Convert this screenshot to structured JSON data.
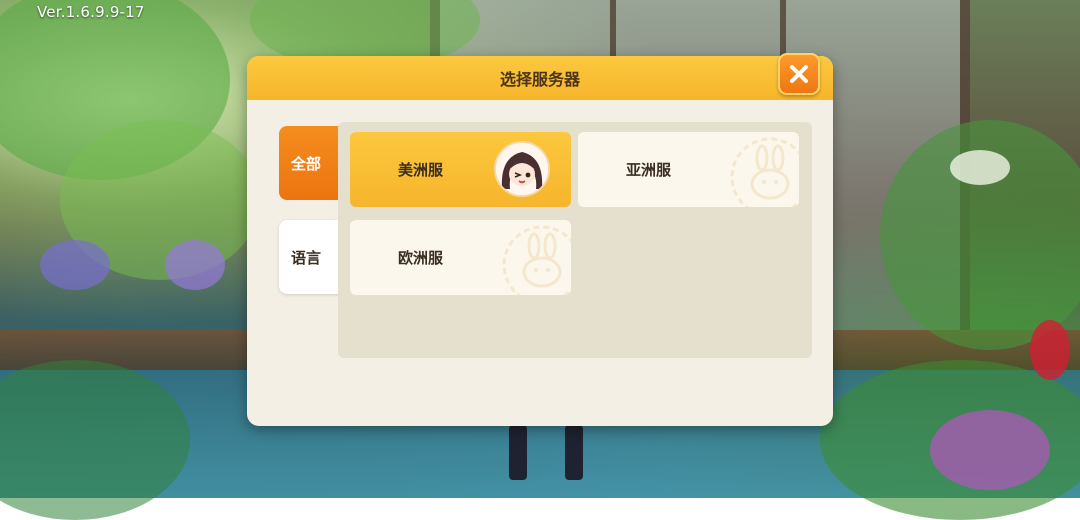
{
  "version": "Ver.1.6.9.9-17",
  "dialog": {
    "title": "选择服务器",
    "close_icon": "close-icon"
  },
  "tabs": [
    {
      "label": "全部",
      "active": true
    },
    {
      "label": "语言",
      "active": false
    }
  ],
  "servers": [
    {
      "label": "美洲服",
      "selected": true
    },
    {
      "label": "亚洲服",
      "selected": false
    },
    {
      "label": "欧洲服",
      "selected": false
    }
  ],
  "colors": {
    "accent_orange": "#ef7612",
    "header_yellow": "#f6b52b",
    "panel_bg": "#f4efe4",
    "list_bg": "#e4e0cd"
  }
}
